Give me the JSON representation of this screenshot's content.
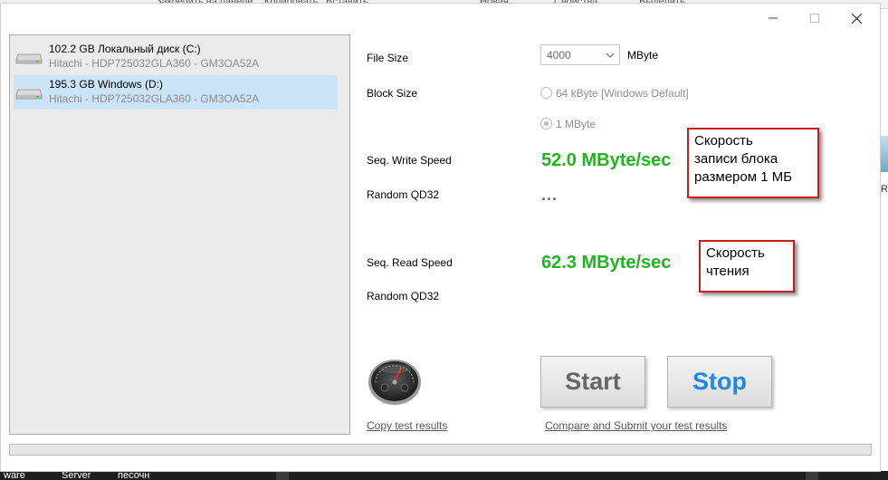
{
  "background": {
    "explorer_items": [
      "Закрепить на панели",
      "Копировать",
      "Вставить",
      "Новая",
      "Свойства",
      "Выделить"
    ],
    "right_fragment": "Re",
    "taskbar_items": [
      "ware",
      "Server",
      "песочн"
    ]
  },
  "window": {
    "controls": {
      "minimize": "minimize-icon",
      "maximize": "maximize-icon",
      "close": "close-icon"
    }
  },
  "drives": [
    {
      "name": "102.2 GB Локальный диск (C:)",
      "model": "Hitachi - HDP725032GLA360 - GM3OA52A",
      "selected": false
    },
    {
      "name": "195.3 GB Windows (D:)",
      "model": "Hitachi - HDP725032GLA360 - GM3OA52A",
      "selected": true
    }
  ],
  "settings": {
    "file_size_label": "File Size",
    "file_size_value": "4000",
    "file_size_unit": "MByte",
    "block_size_label": "Block Size",
    "block_options": [
      {
        "label": "64 kByte [Windows Default]",
        "checked": false
      },
      {
        "label": "1 MByte",
        "checked": true
      }
    ]
  },
  "results": {
    "seq_write_label": "Seq. Write Speed",
    "seq_write_value": "52.0 MByte/sec",
    "random_write_label": "Random QD32",
    "random_write_value": "...",
    "seq_read_label": "Seq. Read Speed",
    "seq_read_value": "62.3 MByte/sec",
    "random_read_label": "Random QD32"
  },
  "annotations": {
    "write": [
      "Скорость",
      "записи блока",
      "размером 1 МБ"
    ],
    "read": [
      "Скорость",
      "чтения"
    ]
  },
  "actions": {
    "start_label": "Start",
    "stop_label": "Stop",
    "copy_results_link": "Copy test results",
    "compare_link": "Compare and Submit your test results"
  },
  "progress": {
    "fraction": 0.0
  },
  "colors": {
    "speed_green": "#1fb51f",
    "stop_blue": "#1e88e5",
    "annotation_red": "#d11a1a",
    "selected_row": "#cce4f7"
  }
}
